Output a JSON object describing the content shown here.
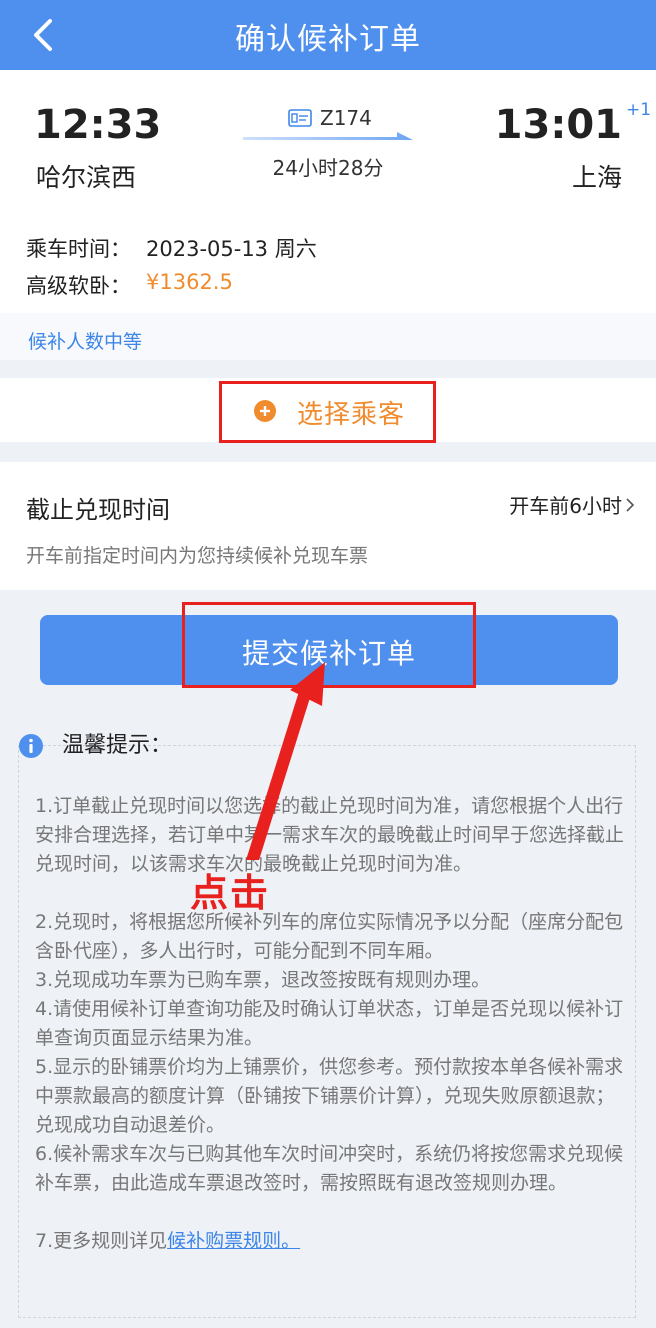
{
  "header": {
    "title": "确认候补订单",
    "back_icon": "chevron-left-icon"
  },
  "trip": {
    "dep_time": "12:33",
    "dep_station": "哈尔滨西",
    "arr_time": "13:01",
    "arr_day_offset": "+1",
    "arr_station": "上海",
    "train_no": "Z174",
    "duration": "24小时28分"
  },
  "info": {
    "date_label": "乘车时间：",
    "date_value": "2023-05-13 周六",
    "seat_label": "高级软卧：",
    "seat_price": "¥1362.5"
  },
  "hint": "候补人数中等",
  "passenger": {
    "label": "选择乘客",
    "icon": "plus-circle-icon"
  },
  "deadline": {
    "title": "截止兑现时间",
    "value": "开车前6小时",
    "desc": "开车前指定时间内为您持续候补兑现车票"
  },
  "submit_label": "提交候补订单",
  "annotation": "点击",
  "tips": {
    "title": "温馨提示：",
    "items": [
      "1.订单截止兑现时间以您选择的截止兑现时间为准，请您根据个人出行安排合理选择，若订单中某一需求车次的最晚截止时间早于您选择截止兑现时间，以该需求车次的最晚截止兑现时间为准。",
      "2.兑现时，将根据您所候补列车的席位实际情况予以分配（座席分配包含卧代座），多人出行时，可能分配到不同车厢。",
      "3.兑现成功车票为已购车票，退改签按既有规则办理。",
      "4.请使用候补订单查询功能及时确认订单状态，订单是否兑现以候补订单查询页面显示结果为准。",
      "5.显示的卧铺票价均为上铺票价，供您参考。预付款按本单各候补需求中票款最高的额度计算（卧铺按下铺票价计算），兑现失败原额退款；兑现成功自动退差价。",
      "6.候补需求车次与已购其他车次时间冲突时，系统仍将按您需求兑现候补车票，由此造成车票退改签时，需按照既有退改签规则办理。"
    ],
    "last_prefix": "7.更多规则详见",
    "last_link": "候补购票规则。"
  },
  "colors": {
    "brand_blue": "#4f8fee",
    "price_orange": "#f08c2e",
    "annotation_red": "#e8211f",
    "link_blue": "#3d86e8"
  }
}
